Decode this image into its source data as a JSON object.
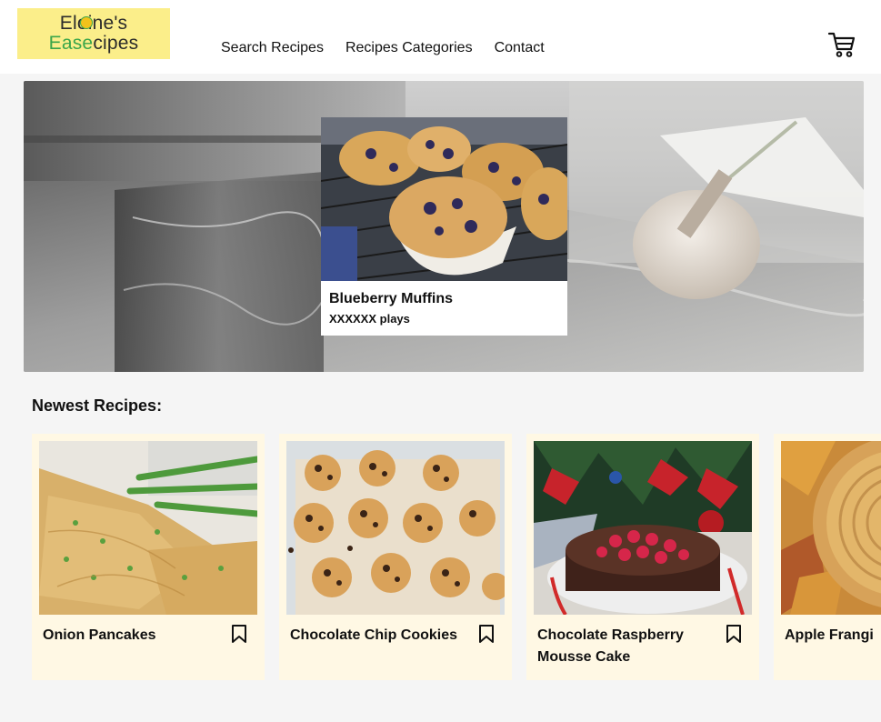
{
  "logo": {
    "line1": "Eloine's",
    "line2_a": "Ease",
    "line2_b": "cipes"
  },
  "nav": {
    "search": "Search Recipes",
    "categories": "Recipes Categories",
    "contact": "Contact"
  },
  "icons": {
    "cart": "shopping-cart-icon",
    "bookmark": "bookmark-icon"
  },
  "featured": {
    "title": "Blueberry Muffins",
    "plays": "XXXXXX plays"
  },
  "newest": {
    "heading": "Newest Recipes:",
    "cards": [
      {
        "title": "Onion Pancakes"
      },
      {
        "title": "Chocolate Chip Cookies"
      },
      {
        "title": "Chocolate Raspberry Mousse Cake"
      },
      {
        "title": "Apple Frangi"
      }
    ]
  },
  "colors": {
    "logo_bg": "#fbee8a",
    "logo_green": "#3aa64a",
    "card_bg": "#fff8e4",
    "page_bg": "#f5f5f5"
  }
}
